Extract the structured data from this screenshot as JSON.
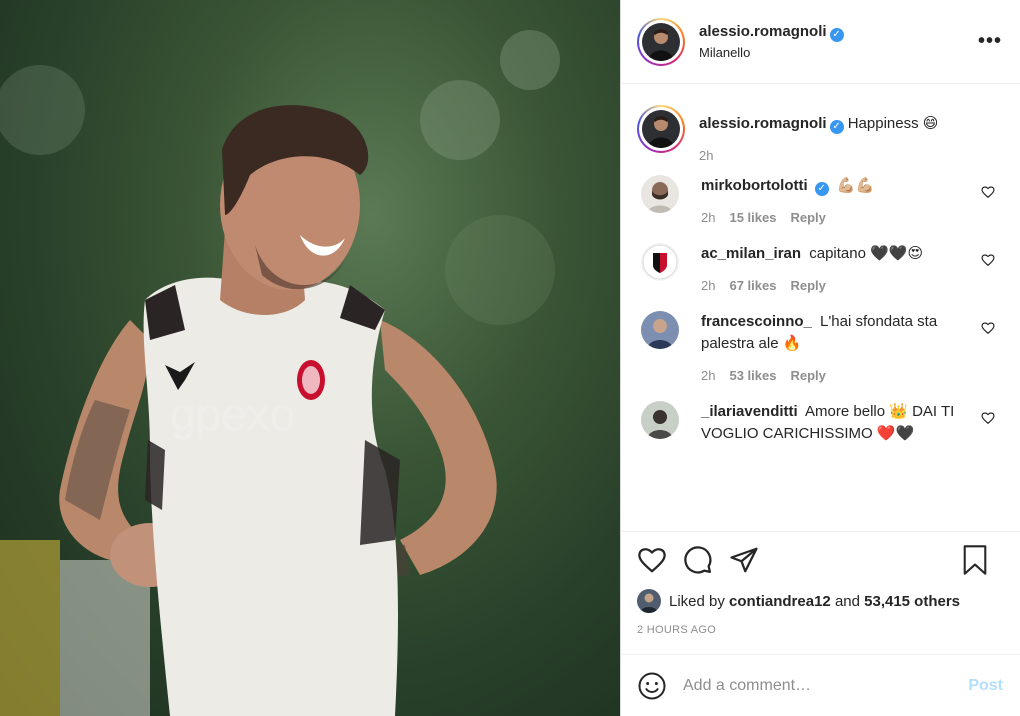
{
  "post": {
    "photo_alt": "",
    "watermark": "gpexo"
  },
  "header": {
    "username": "alessio.romagnoli",
    "location": "Milanello",
    "more_label": "•••"
  },
  "caption": {
    "username": "alessio.romagnoli",
    "text": "Happiness 😄",
    "time": "2h"
  },
  "comments": [
    {
      "username": "mirkobortolotti",
      "verified": true,
      "text": "💪🏼💪🏼",
      "time": "2h",
      "likes": "15 likes",
      "reply": "Reply"
    },
    {
      "username": "ac_milan_iran",
      "verified": false,
      "text": "capitano 🖤🖤😍",
      "time": "2h",
      "likes": "67 likes",
      "reply": "Reply"
    },
    {
      "username": "francescoinno_",
      "verified": false,
      "text": "L'hai sfondata sta palestra ale 🔥",
      "time": "2h",
      "likes": "53 likes",
      "reply": "Reply"
    },
    {
      "username": "_ilariavenditti",
      "verified": false,
      "text": "Amore bello 👑 DAI TI VOGLIO CARICHISSIMO ❤️🖤",
      "time": "",
      "likes": "",
      "reply": ""
    }
  ],
  "likes": {
    "prefix": "Liked by",
    "user": "contiandrea12",
    "and": "and",
    "count": "53,415 others"
  },
  "time_ago": "2 HOURS AGO",
  "add_comment": {
    "placeholder": "Add a comment…",
    "post_label": "Post"
  },
  "colors": {
    "verified": "#3897f0",
    "post_disabled": "#b2dffc",
    "secondary_text": "#8e8e8e"
  }
}
